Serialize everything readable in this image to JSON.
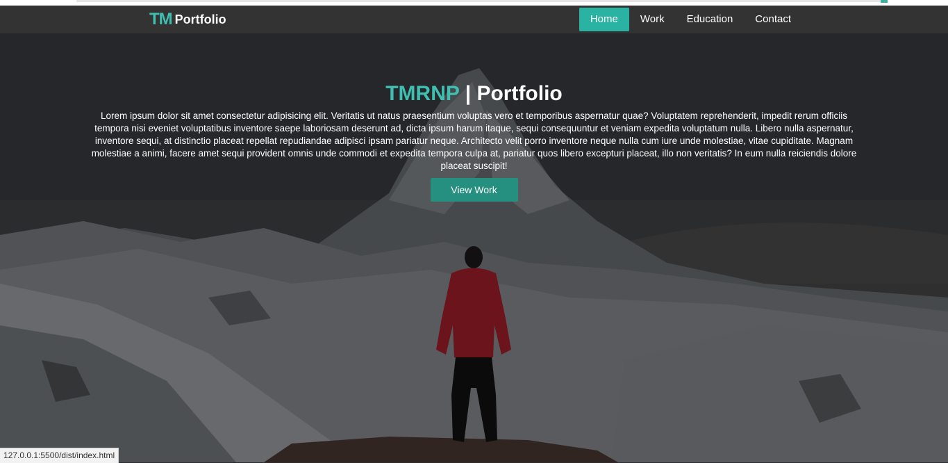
{
  "brand": {
    "mark": "TM",
    "name": "Portfolio"
  },
  "nav": {
    "items": [
      {
        "label": "Home",
        "active": true
      },
      {
        "label": "Work",
        "active": false
      },
      {
        "label": "Education",
        "active": false
      },
      {
        "label": "Contact",
        "active": false
      }
    ]
  },
  "hero": {
    "title_accent": "TMRNP",
    "title_separator": " | ",
    "title_main": "Portfolio",
    "text": "Lorem ipsum dolor sit amet consectetur adipisicing elit. Veritatis ut natus praesentium voluptas vero et temporibus aspernatur quae? Voluptatem reprehenderit, impedit rerum officiis tempora nisi eveniet voluptatibus inventore saepe laboriosam deserunt ad, dicta ipsum harum itaque, sequi consequuntur et veniam expedita voluptatum nulla. Libero nulla aspernatur, inventore sequi, at distinctio placeat repellat repudiandae adipisci ipsam pariatur neque. Architecto velit porro inventore neque nulla cum iure unde molestiae, vitae cupiditate. Magnam molestiae a animi, facere amet sequi provident omnis unde commodi et expedita tempora culpa at, pariatur quos libero excepturi placeat, illo non veritatis? In eum nulla reiciendis dolore placeat suscipit!",
    "button": "View Work"
  },
  "status_url": "127.0.0.1:5500/dist/index.html",
  "colors": {
    "accent": "#3fbfb0",
    "nav_active": "#2ab3a2",
    "button": "#25907f",
    "navbar": "#333333"
  }
}
